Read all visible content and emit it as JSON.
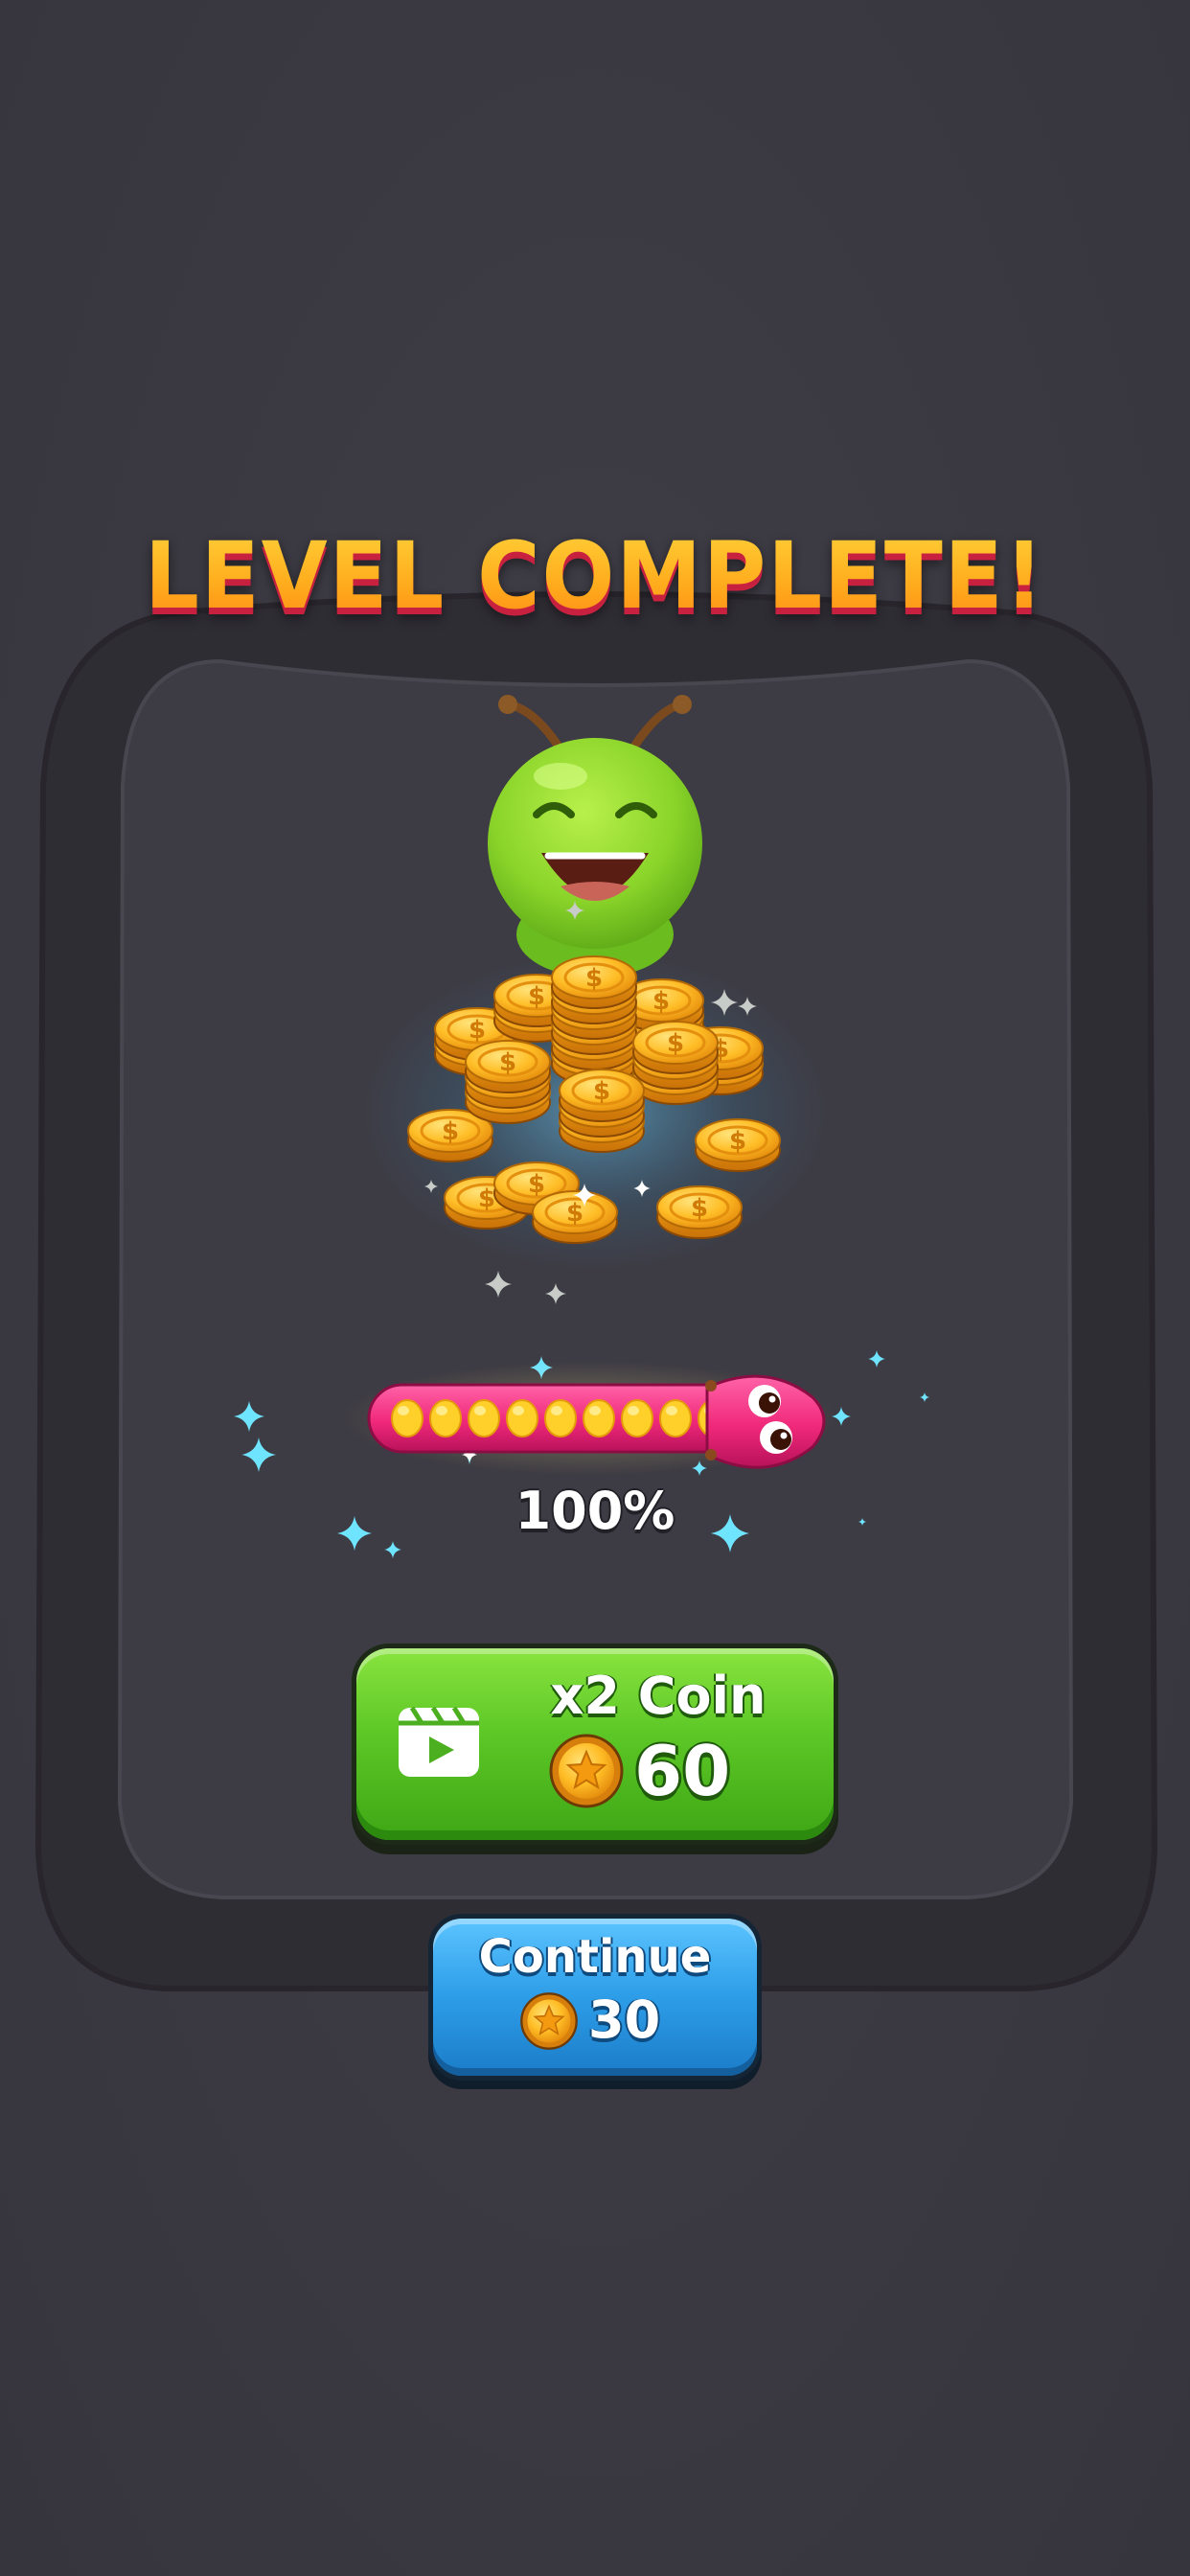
{
  "title": "LEVEL COMPLETE!",
  "progress": {
    "label": "100%",
    "value": 1.0
  },
  "reward_button": {
    "label": "x2 Coin",
    "amount": "60",
    "icon": "video-icon"
  },
  "continue_button": {
    "label": "Continue",
    "amount": "30"
  },
  "colors": {
    "background": "#3c3a42",
    "frame": "#2f2d34",
    "title_fill": "#ffb21c",
    "title_outline": "#c8213f",
    "green_button": "#5cc726",
    "blue_button": "#2d9de8",
    "coin": "#f7a81a",
    "caterpillar_green": "#8ad42a",
    "worm_pink": "#f0287a",
    "sparkle": "#5ae0ff"
  }
}
